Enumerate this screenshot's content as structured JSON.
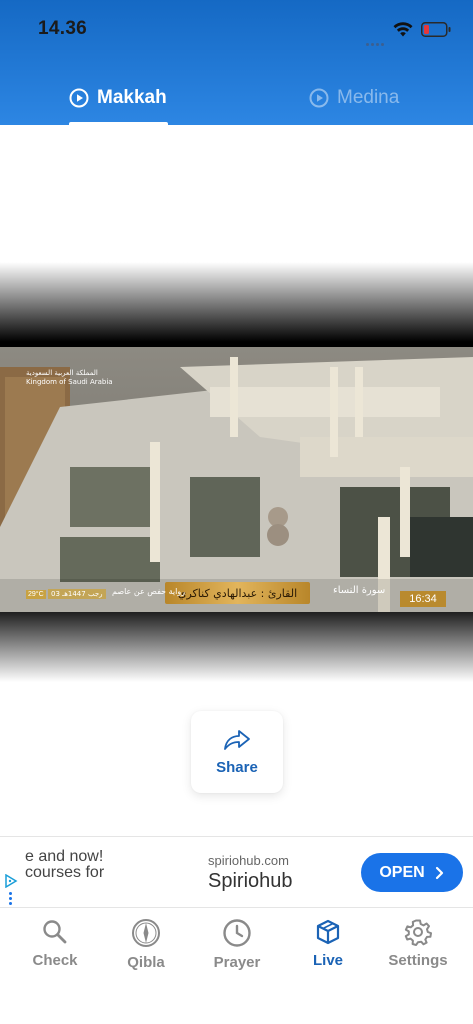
{
  "status_bar": {
    "time": "14.36"
  },
  "tabs": [
    {
      "label": "Makkah",
      "active": true
    },
    {
      "label": "Medina",
      "active": false
    }
  ],
  "video": {
    "watermark_arabic": "المملكة العربية السعودية",
    "watermark_english": "Kingdom of Saudi Arabia",
    "reciter_caption": "القارئ : عبدالهادي كناكري",
    "surah": "سورة النساء",
    "riwaya": "رواية حفص عن عاصم",
    "temperature": "29°C",
    "hijri_date": "03 رجب 1447هـ",
    "clock": "16:34"
  },
  "share": {
    "label": "Share",
    "icon": "share-arrow-icon"
  },
  "ad": {
    "line1": "e and now!",
    "line2": "courses for",
    "domain": "spiriohub.com",
    "name": "Spiriohub",
    "cta": "OPEN"
  },
  "nav": [
    {
      "label": "Check",
      "icon": "search-icon",
      "active": false
    },
    {
      "label": "Qibla",
      "icon": "compass-icon",
      "active": false
    },
    {
      "label": "Prayer",
      "icon": "clock-icon",
      "active": false
    },
    {
      "label": "Live",
      "icon": "cube-icon",
      "active": true
    },
    {
      "label": "Settings",
      "icon": "gear-icon",
      "active": false
    }
  ],
  "colors": {
    "header_top": "#1569c4",
    "header_bottom": "#2d86e3",
    "accent": "#1b63b5",
    "ad_button": "#1a73e8",
    "inactive": "#8a8a8a"
  }
}
